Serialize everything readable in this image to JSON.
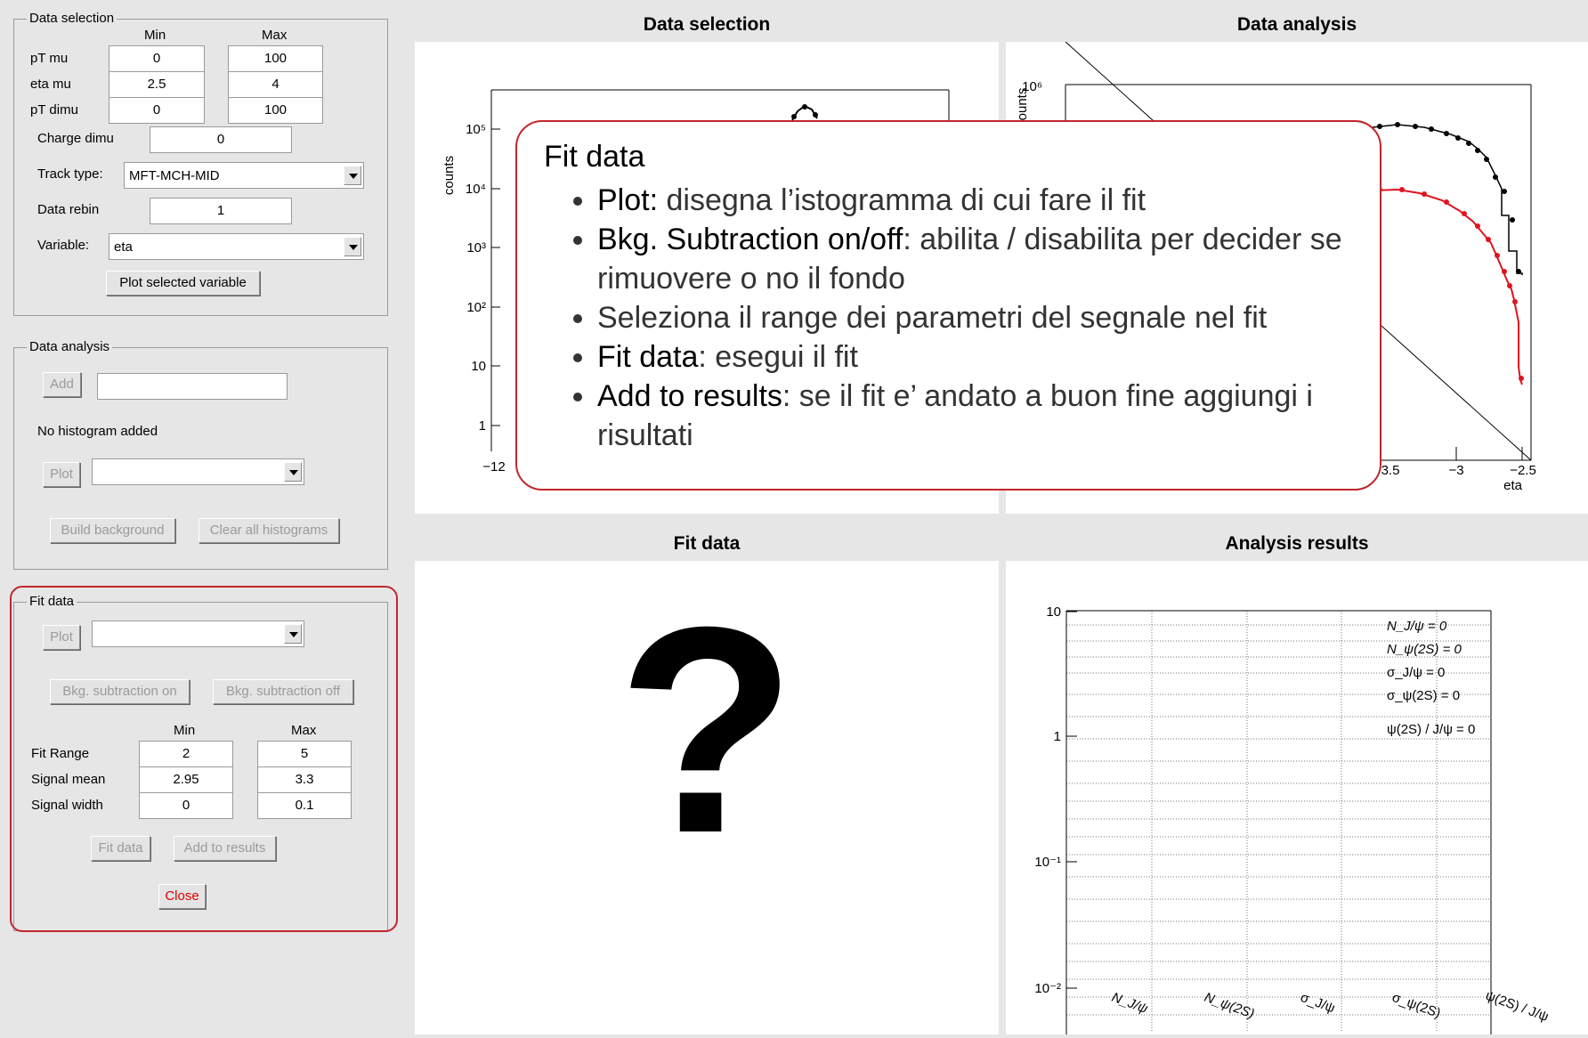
{
  "sel": {
    "title": "Data selection",
    "min_head": "Min",
    "max_head": "Max",
    "rows": [
      {
        "label": "pT mu",
        "min": "0",
        "max": "100"
      },
      {
        "label": "eta mu",
        "min": "2.5",
        "max": "4"
      },
      {
        "label": "pT dimu",
        "min": "0",
        "max": "100"
      }
    ],
    "charge_label": "Charge dimu",
    "charge_value": "0",
    "track_label": "Track type:",
    "track_value": "MFT-MCH-MID",
    "rebin_label": "Data rebin",
    "rebin_value": "1",
    "variable_label": "Variable:",
    "variable_value": "eta",
    "plot_button": "Plot selected variable"
  },
  "ana": {
    "title": "Data analysis",
    "add_button": "Add",
    "add_value": "",
    "status": "No histogram added",
    "plot_button": "Plot",
    "plot_value": "",
    "build_bkg_button": "Build background",
    "clear_button": "Clear all histograms"
  },
  "fit": {
    "title": "Fit data",
    "plot_button": "Plot",
    "plot_value": "",
    "bkg_on_button": "Bkg. subtraction on",
    "bkg_off_button": "Bkg. subtraction off",
    "min_head": "Min",
    "max_head": "Max",
    "rows": [
      {
        "label": "Fit Range",
        "min": "2",
        "max": "5"
      },
      {
        "label": "Signal mean",
        "min": "2.95",
        "max": "3.3"
      },
      {
        "label": "Signal width",
        "min": "0",
        "max": "0.1"
      }
    ],
    "fit_button": "Fit data",
    "add_results_button": "Add to results",
    "close_button": "Close"
  },
  "pads": {
    "selection_title": "Data selection",
    "analysis_title": "Data analysis",
    "fit_title": "Fit data",
    "results_title": "Analysis results",
    "fit_placeholder": "?"
  },
  "selection_plot": {
    "ylabel": "counts",
    "yticks": [
      "10⁵",
      "10⁴",
      "10³",
      "10²",
      "10",
      "1"
    ],
    "xtick_first": "−12"
  },
  "analysis_plot": {
    "ylabel": "ounts",
    "ytop": "10⁶",
    "xticks": [
      "3.5",
      "−3",
      "−2.5"
    ],
    "xlabel": "eta"
  },
  "results_plot": {
    "yticks": [
      "10",
      "1",
      "10⁻¹",
      "10⁻²"
    ],
    "legend": [
      "N_J/ψ = 0",
      "N_ψ(2S) = 0",
      "σ_J/ψ = 0",
      "σ_ψ(2S) = 0",
      "ψ(2S) / J/ψ = 0"
    ],
    "xcats": [
      "N_J/ψ",
      "N_ψ(2S)",
      "σ_J/ψ",
      "σ_ψ(2S)",
      "ψ(2S) / J/ψ"
    ]
  },
  "callout": {
    "title": "Fit data",
    "items": [
      {
        "bold": "Plot:",
        "text": " disegna l’istogramma di cui fare il fit"
      },
      {
        "bold": "Bkg. Subtraction on/off",
        "text": ": abilita / disabilita per decider se rimuovere o no il fondo"
      },
      {
        "bold": "",
        "text": "Seleziona il range dei parametri del segnale nel fit"
      },
      {
        "bold": "Fit data",
        "text": ": esegui il fit"
      },
      {
        "bold": "Add to results",
        "text": ": se il fit e’ andato a buon fine aggiungi i risultati"
      }
    ]
  },
  "colors": {
    "highlight": "#c0272d",
    "close_text": "#e00000",
    "fit_red": "#e0141e"
  }
}
